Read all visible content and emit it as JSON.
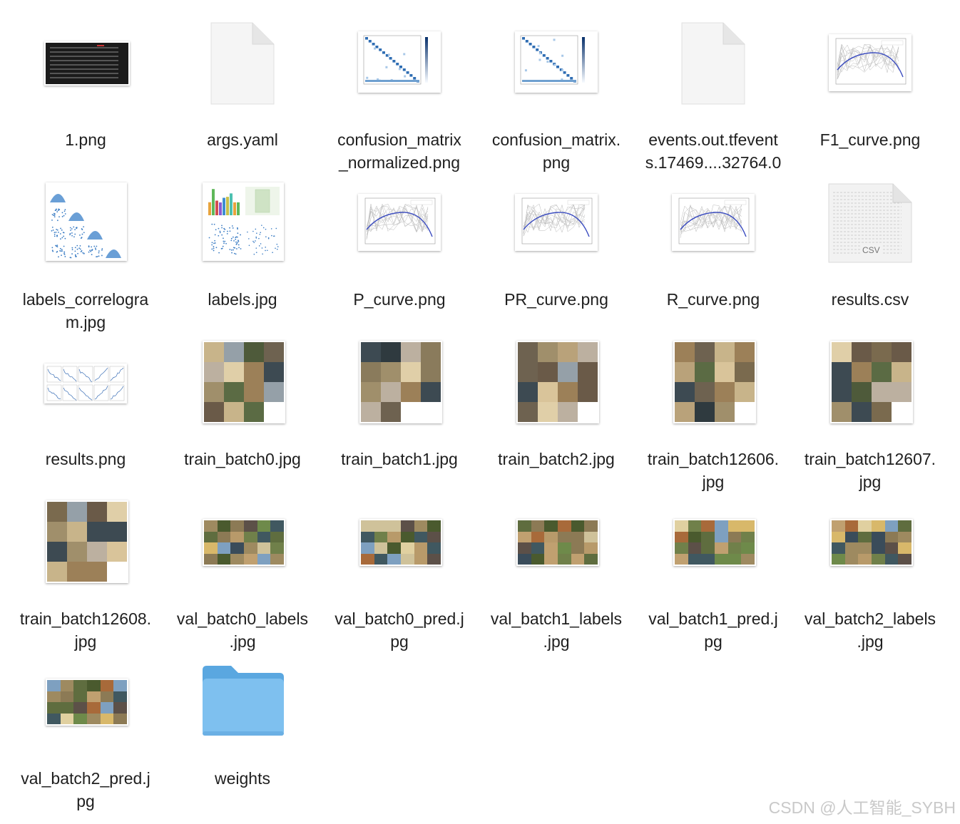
{
  "files": [
    {
      "name": "1.png",
      "icon": "screenshot-thumbnail"
    },
    {
      "name": "args.yaml",
      "icon": "document-icon"
    },
    {
      "name": "confusion_matrix_normalized.png",
      "icon": "confusion-matrix-thumbnail"
    },
    {
      "name": "confusion_matrix.png",
      "icon": "confusion-matrix-thumbnail"
    },
    {
      "name": "events.out.tfevents.17469....32764.0",
      "icon": "document-icon"
    },
    {
      "name": "F1_curve.png",
      "icon": "curve-plot-thumbnail"
    },
    {
      "name": "labels_correlogram.jpg",
      "icon": "correlogram-thumbnail"
    },
    {
      "name": "labels.jpg",
      "icon": "labels-plot-thumbnail"
    },
    {
      "name": "P_curve.png",
      "icon": "curve-plot-thumbnail"
    },
    {
      "name": "PR_curve.png",
      "icon": "curve-plot-thumbnail"
    },
    {
      "name": "R_curve.png",
      "icon": "curve-plot-thumbnail"
    },
    {
      "name": "results.csv",
      "icon": "csv-document-icon",
      "badge": "CSV"
    },
    {
      "name": "results.png",
      "icon": "results-plot-thumbnail"
    },
    {
      "name": "train_batch0.jpg",
      "icon": "photo-grid-thumbnail"
    },
    {
      "name": "train_batch1.jpg",
      "icon": "photo-grid-thumbnail"
    },
    {
      "name": "train_batch2.jpg",
      "icon": "photo-grid-thumbnail"
    },
    {
      "name": "train_batch12606.jpg",
      "icon": "photo-grid-thumbnail"
    },
    {
      "name": "train_batch12607.jpg",
      "icon": "photo-grid-thumbnail"
    },
    {
      "name": "train_batch12608.jpg",
      "icon": "photo-grid-thumbnail"
    },
    {
      "name": "val_batch0_labels.jpg",
      "icon": "photo-mosaic-thumbnail"
    },
    {
      "name": "val_batch0_pred.jpg",
      "icon": "photo-mosaic-thumbnail"
    },
    {
      "name": "val_batch1_labels.jpg",
      "icon": "photo-mosaic-thumbnail"
    },
    {
      "name": "val_batch1_pred.jpg",
      "icon": "photo-mosaic-thumbnail"
    },
    {
      "name": "val_batch2_labels.jpg",
      "icon": "photo-mosaic-thumbnail"
    },
    {
      "name": "val_batch2_pred.jpg",
      "icon": "photo-mosaic-thumbnail"
    },
    {
      "name": "weights",
      "icon": "folder-icon"
    }
  ],
  "labels": [
    "1.png",
    "args.yaml",
    "confusion_matrix\n_normalized.png",
    "confusion_matrix.\npng",
    "events.out.tfevent\ns.17469....32764.0",
    "F1_curve.png",
    "labels_correlogra\nm.jpg",
    "labels.jpg",
    "P_curve.png",
    "PR_curve.png",
    "R_curve.png",
    "results.csv",
    "results.png",
    "train_batch0.jpg",
    "train_batch1.jpg",
    "train_batch2.jpg",
    "train_batch12606.\njpg",
    "train_batch12607.\njpg",
    "train_batch12608.\njpg",
    "val_batch0_labels\n.jpg",
    "val_batch0_pred.j\npg",
    "val_batch1_labels\n.jpg",
    "val_batch1_pred.j\npg",
    "val_batch2_labels\n.jpg",
    "val_batch2_pred.j\npg",
    "weights"
  ],
  "watermark": "CSDN @人工智能_SYBH",
  "colors": {
    "folder": "#7ec0ef",
    "folder_tab": "#5aa7e0",
    "plot_line": "#3b4cc0",
    "dark_thumb": "#1b1b1b"
  }
}
